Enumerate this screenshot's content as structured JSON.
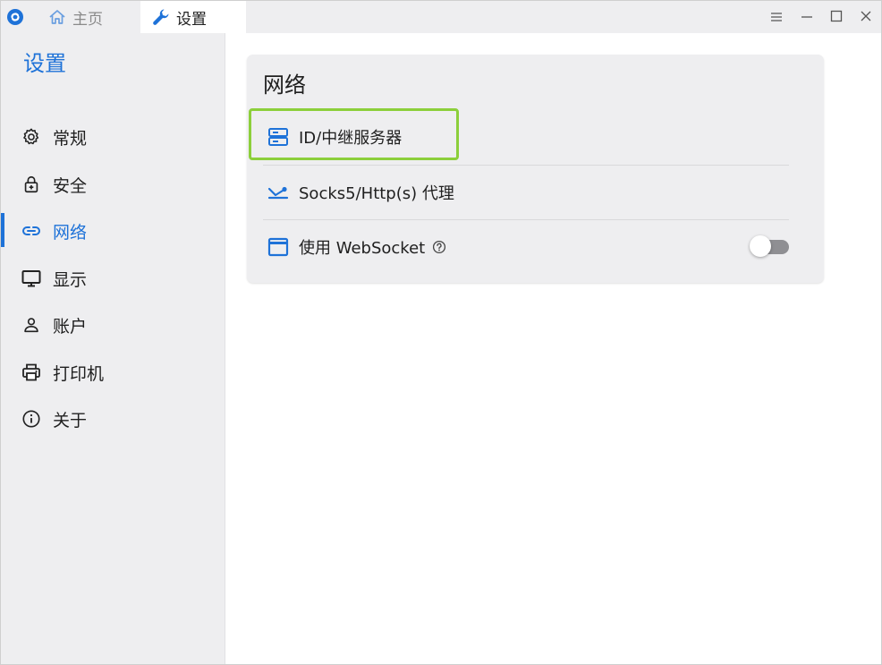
{
  "titlebar": {
    "tabs": [
      {
        "label": "主页",
        "icon": "home-icon"
      },
      {
        "label": "设置",
        "icon": "wrench-icon"
      }
    ],
    "controls": [
      "menu-icon",
      "minimize-icon",
      "maximize-icon",
      "close-icon"
    ]
  },
  "sidebar": {
    "title": "设置",
    "items": [
      {
        "label": "常规",
        "icon": "gear-icon"
      },
      {
        "label": "安全",
        "icon": "lock-icon"
      },
      {
        "label": "网络",
        "icon": "link-icon",
        "active": true
      },
      {
        "label": "显示",
        "icon": "monitor-icon"
      },
      {
        "label": "账户",
        "icon": "person-icon"
      },
      {
        "label": "打印机",
        "icon": "printer-icon"
      },
      {
        "label": "关于",
        "icon": "info-icon"
      }
    ]
  },
  "main": {
    "card_title": "网络",
    "rows": [
      {
        "label": "ID/中继服务器",
        "icon": "server-icon"
      },
      {
        "label": "Socks5/Http(s) 代理",
        "icon": "proxy-icon"
      },
      {
        "label": "使用 WebSocket",
        "icon": "window-icon",
        "toggle_on": false
      }
    ]
  },
  "colors": {
    "accent": "#1e72d8",
    "highlight": "#8ccf3b",
    "sidebar_bg": "#eeeef0"
  }
}
